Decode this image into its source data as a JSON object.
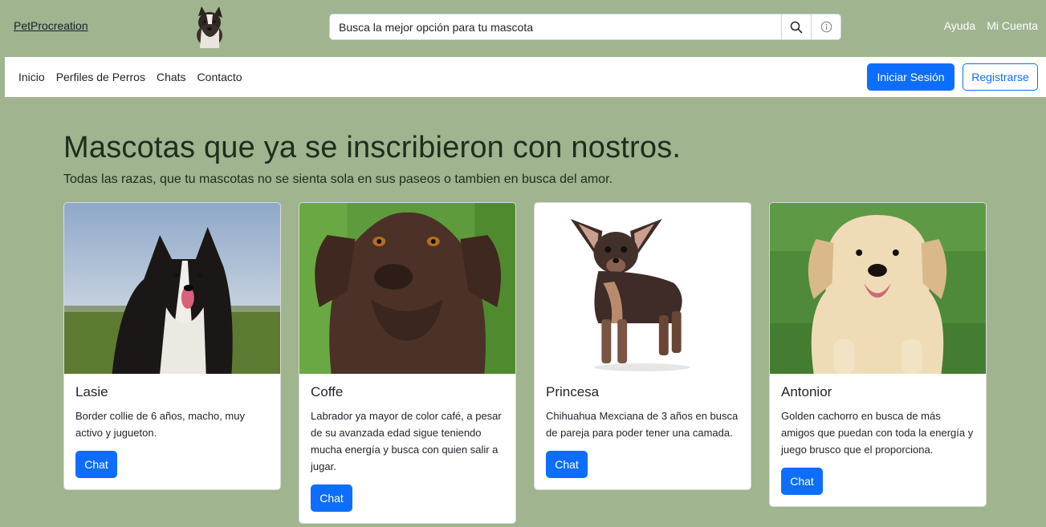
{
  "header": {
    "brand": "PetProcreation",
    "search_placeholder": "Busca la mejor opción para tu mascota",
    "links": [
      "Ayuda",
      "Mi Cuenta"
    ]
  },
  "nav": {
    "links": [
      "Inicio",
      "Perfiles de Perros",
      "Chats",
      "Contacto"
    ],
    "login_label": "Iniciar Sesión",
    "register_label": "Registrarse"
  },
  "hero": {
    "title": "Mascotas que ya se inscribieron con nostros.",
    "subtitle": "Todas las razas, que tu mascotas no se sienta sola en sus paseos o tambien en busca del amor."
  },
  "cards": [
    {
      "name": "Lasie",
      "description": "Border collie de 6 años, macho, muy activo y jugueton.",
      "button": "Chat"
    },
    {
      "name": "Coffe",
      "description": "Labrador ya mayor de color café, a pesar de su avanzada edad sigue teniendo mucha energía y busca con quien salir a jugar.",
      "button": "Chat"
    },
    {
      "name": "Princesa",
      "description": "Chihuahua Mexciana de 3 años en busca de pareja para poder tener una camada.",
      "button": "Chat"
    },
    {
      "name": "Antonior",
      "description": "Golden cachorro en busca de más amigos que puedan con toda la energía y juego brusco que el proporciona.",
      "button": "Chat"
    }
  ],
  "colors": {
    "background": "#9fb48f",
    "primary": "#0d6efd"
  }
}
